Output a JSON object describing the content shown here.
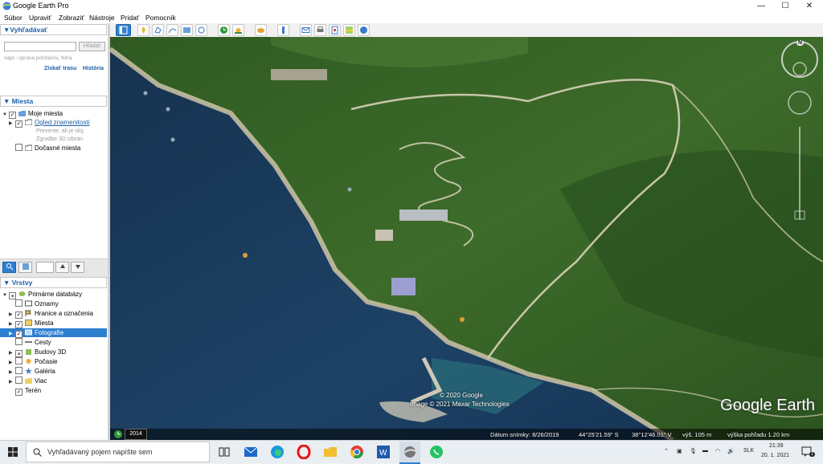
{
  "window": {
    "title": "Google Earth Pro",
    "controls": {
      "minimize": "—",
      "maximize": "☐",
      "close": "✕"
    }
  },
  "menu": [
    "Súbor",
    "Upraviť",
    "Zobraziť",
    "Nástroje",
    "Pridať",
    "Pomocník"
  ],
  "search": {
    "header": "▼Vyhľadávať",
    "input_value": "",
    "button_label": "Hľadať",
    "hint": "napr.: oprava počítačov, Nitra",
    "link_route": "Získať trasu",
    "link_history": "História"
  },
  "places": {
    "header": "▼ Miesta",
    "items": [
      {
        "label": "Moje miesta"
      },
      {
        "label": "Ogled znamenitosti",
        "link": true
      },
      {
        "label": "Prevente, ali je sloj"
      },
      {
        "label": "Zgradbe 3D izbran"
      },
      {
        "label": "Dočasné miesta"
      }
    ]
  },
  "layers": {
    "header": "▼ Vrstvy",
    "items": [
      {
        "label": "Primárne databázy"
      },
      {
        "label": "Oznamy"
      },
      {
        "label": "Hranice a označenia"
      },
      {
        "label": "Miesta"
      },
      {
        "label": "Fotografie"
      },
      {
        "label": "Cesty"
      },
      {
        "label": "Budovy 3D"
      },
      {
        "label": "Počasie"
      },
      {
        "label": "Galéria"
      },
      {
        "label": "Viac"
      },
      {
        "label": "Terén"
      }
    ]
  },
  "map": {
    "copyright_1": "© 2020 Google",
    "copyright_2": "Image © 2021 Maxar Technologies",
    "logo": "Google Earth",
    "year": "2014",
    "image_date": "Dátum snímky: 8/26/2019",
    "lat": "44°25'21.59\" S",
    "lon": "38°12'46.01\" V",
    "elev": "výš.   105 m",
    "eye_alt": "výška pohľadu   1.20 km",
    "compass_n": "N"
  },
  "taskbar": {
    "search_placeholder": "Vyhľadávaný pojem napíšte sem",
    "lang": "SLK",
    "time": "21:39",
    "date": "20. 1. 2021",
    "notif_count": "1"
  },
  "colors": {
    "accent": "#1c5fa8",
    "selected": "#2f7fd0",
    "sea": "#1b3b5e",
    "forest": "#3d6b2a"
  }
}
